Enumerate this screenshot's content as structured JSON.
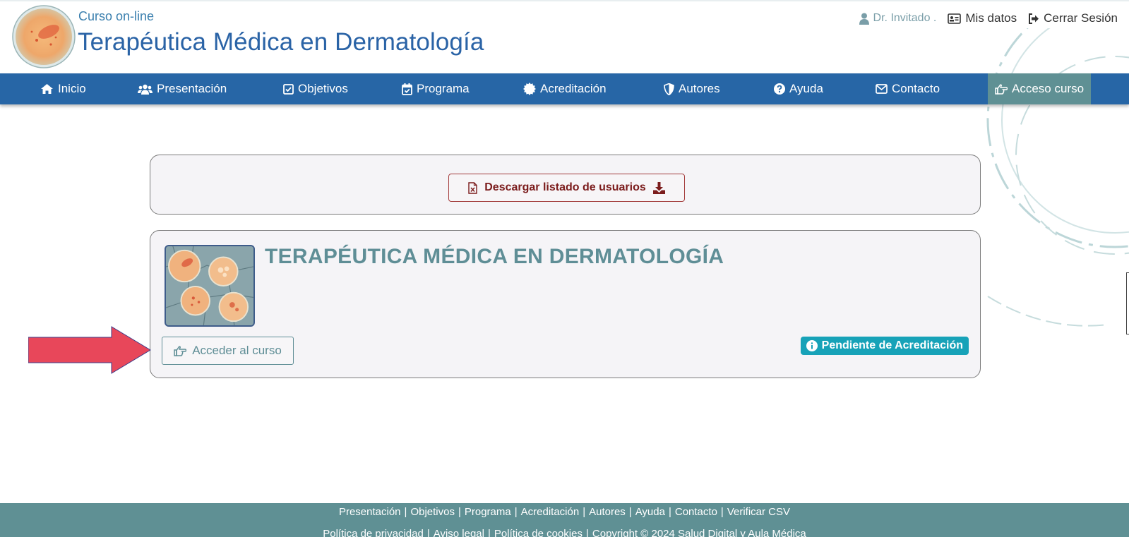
{
  "header": {
    "subtitle": "Curso on-line",
    "title": "Terapéutica Médica en Dermatología",
    "user_name": "Dr. Invitado .",
    "mis_datos": "Mis datos",
    "logout": "Cerrar Sesión"
  },
  "nav": {
    "items": [
      {
        "label": "Inicio",
        "icon": "home-icon"
      },
      {
        "label": "Presentación",
        "icon": "users-icon"
      },
      {
        "label": "Objetivos",
        "icon": "check-square-icon"
      },
      {
        "label": "Programa",
        "icon": "calendar-check-icon"
      },
      {
        "label": "Acreditación",
        "icon": "certificate-icon"
      },
      {
        "label": "Autores",
        "icon": "shield-icon"
      },
      {
        "label": "Ayuda",
        "icon": "question-circle-icon"
      },
      {
        "label": "Contacto",
        "icon": "envelope-icon"
      },
      {
        "label": "Acceso curso",
        "icon": "hand-point-right-icon",
        "active": true
      }
    ]
  },
  "download": {
    "label": "Descargar listado de usuarios"
  },
  "course": {
    "title": "TERAPÉUTICA MÉDICA EN DERMATOLOGÍA",
    "access_label": "Acceder al curso",
    "status": "Pendiente de Acreditación"
  },
  "footer": {
    "row1": [
      "Presentación",
      "Objetivos",
      "Programa",
      "Acreditación",
      "Autores",
      "Ayuda",
      "Contacto",
      "Verificar CSV"
    ],
    "row2": [
      "Política de privacidad",
      "Aviso legal",
      "Política de cookies",
      "Copyright © 2024 Salud Digital y Aula Médica"
    ]
  },
  "colors": {
    "nav_bg": "#2766a6",
    "nav_active": "#5f9094",
    "title": "#2a63a6",
    "course_title": "#5f8e96",
    "badge": "#17a2b8",
    "download_text": "#7b1c1c",
    "arrow": "#e8475a",
    "footer_bg": "#5f9094"
  }
}
